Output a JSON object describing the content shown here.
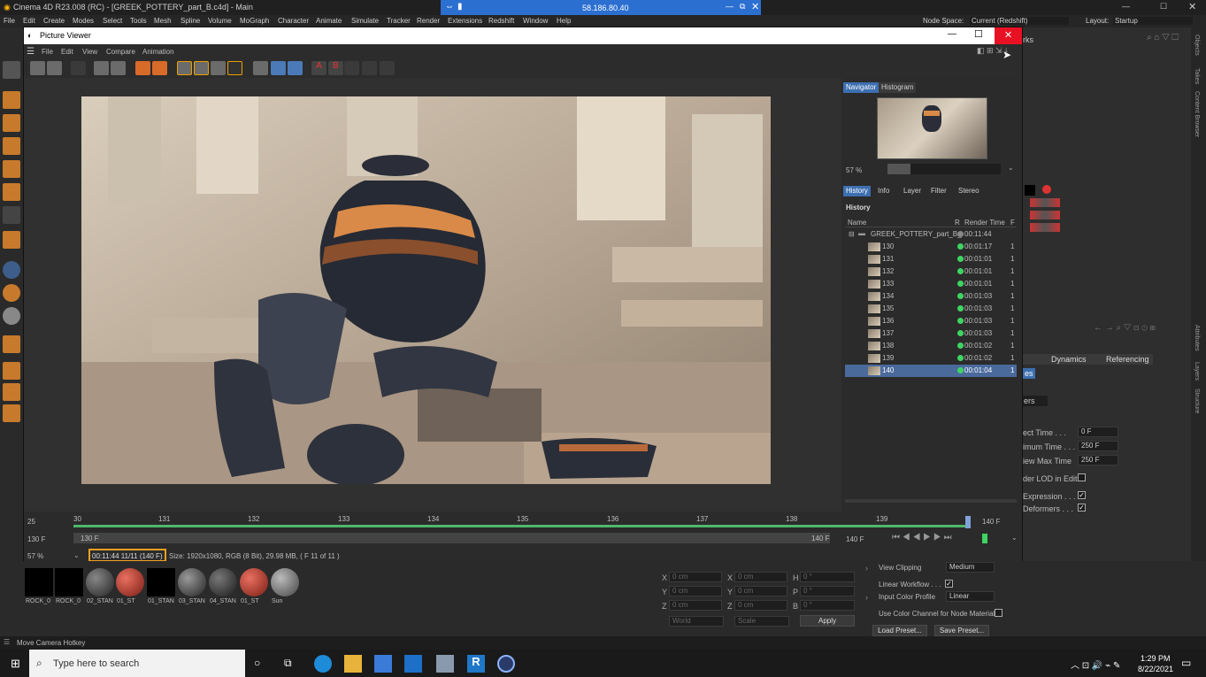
{
  "app": {
    "title": "Cinema 4D R23.008 (RC) - [GREEK_POTTERY_part_B.c4d] - Main",
    "node_space_label": "Node Space:",
    "node_space_value": "Current (Redshift)",
    "layout_label": "Layout:",
    "layout_value": "Startup"
  },
  "remote": {
    "address": "58.186.80.40"
  },
  "menu": [
    "File",
    "Edit",
    "Create",
    "Modes",
    "Select",
    "Tools",
    "Mesh",
    "Spline",
    "Volume",
    "MoGraph",
    "Character",
    "Animate",
    "Simulate",
    "Tracker",
    "Render",
    "Extensions",
    "Redshift",
    "Window",
    "Help"
  ],
  "picture_viewer": {
    "title": "Picture Viewer",
    "menu": [
      "File",
      "Edit",
      "View",
      "Compare",
      "Animation"
    ],
    "nav_tabs": [
      "Navigator",
      "Histogram"
    ],
    "zoom": "57 %",
    "hist_tabs": [
      "History",
      "Info",
      "Layer",
      "Filter",
      "Stereo"
    ],
    "history_title": "History",
    "columns": {
      "name": "Name",
      "r": "R",
      "render_time": "Render Time",
      "f": "F"
    },
    "group": {
      "name": "GREEK_POTTERY_part_B_",
      "time": "00:11:44"
    },
    "rows": [
      {
        "name": "130",
        "time": "00:01:17",
        "f": "1"
      },
      {
        "name": "131",
        "time": "00:01:01",
        "f": "1"
      },
      {
        "name": "132",
        "time": "00:01:01",
        "f": "1"
      },
      {
        "name": "133",
        "time": "00:01:01",
        "f": "1"
      },
      {
        "name": "134",
        "time": "00:01:03",
        "f": "1"
      },
      {
        "name": "135",
        "time": "00:01:03",
        "f": "1"
      },
      {
        "name": "136",
        "time": "00:01:03",
        "f": "1"
      },
      {
        "name": "137",
        "time": "00:01:03",
        "f": "1"
      },
      {
        "name": "138",
        "time": "00:01:02",
        "f": "1"
      },
      {
        "name": "139",
        "time": "00:01:02",
        "f": "1"
      },
      {
        "name": "140",
        "time": "00:01:04",
        "f": "1"
      }
    ],
    "timeline": {
      "current": "25",
      "ticks": [
        "30",
        "131",
        "132",
        "133",
        "134",
        "135",
        "136",
        "137",
        "138",
        "139"
      ],
      "end_label": "140 F",
      "start_field": "130 F",
      "range_start": "130 F",
      "range_end": "140 F",
      "end_field": "140 F"
    },
    "zoom_bottom": "57 %",
    "status_time": "00:11:44 11/11 (140 F)",
    "status_info": "Size: 1920x1080, RGB (8 Bit), 29.98 MB,  ( F 11 of 11 )"
  },
  "right_panel": {
    "objects_label": "rks",
    "tabs": [
      "Dynamics",
      "Referencing"
    ],
    "tab_partial": "es",
    "dropdown_partial": "ers",
    "fields": [
      {
        "label": "ect Time . . .",
        "value": "0 F"
      },
      {
        "label": "imum Time . . .",
        "value": "250 F"
      },
      {
        "label": "iew Max Time",
        "value": "250 F"
      }
    ],
    "lod": "der LOD in Editor",
    "expression": "Expression . . .",
    "deformers": "Deformers . . ."
  },
  "side_strip": [
    "Objects",
    "Takes",
    "Content Browser",
    "Attributes",
    "Layers",
    "Structure"
  ],
  "materials": [
    "ROCK_0",
    "ROCK_0",
    "02_STAN",
    "01_ST",
    "01_STAN",
    "03_STAN",
    "04_STAN",
    "01_ST",
    "Sun"
  ],
  "coords": {
    "x": "X",
    "y": "Y",
    "z": "Z",
    "h": "H",
    "p": "P",
    "b": "B",
    "cm": "0 cm",
    "deg": "0 °",
    "world": "World",
    "scale": "Scale",
    "apply": "Apply"
  },
  "redshift_settings": {
    "view_clipping_label": "View Clipping",
    "view_clipping_value": "Medium",
    "linear_workflow": "Linear Workflow . . .",
    "input_color_label": "Input Color Profile",
    "input_color_value": "Linear",
    "use_color_channel": "Use Color Channel for Node Material",
    "load_preset": "Load Preset...",
    "save_preset": "Save Preset..."
  },
  "status_bar": "Move Camera Hotkey",
  "taskbar": {
    "search_placeholder": "Type here to search",
    "time": "1:29 PM",
    "date": "8/22/2021"
  },
  "colors": {
    "accent": "#3d6fb0",
    "close_red": "#e81123",
    "render_dot": "#3ed462",
    "status_highlight": "#f0a020",
    "remote_bar": "#2b6fd1"
  }
}
